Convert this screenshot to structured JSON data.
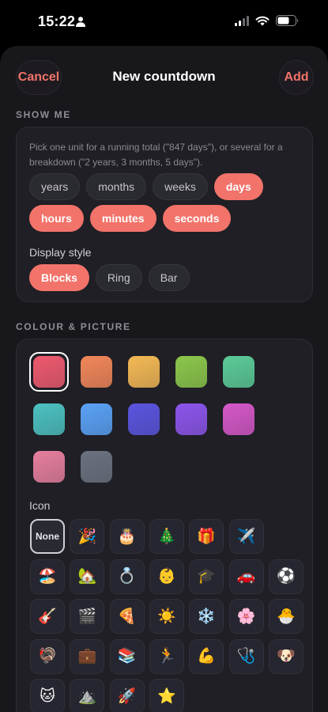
{
  "status": {
    "time": "15:22"
  },
  "nav": {
    "cancel": "Cancel",
    "title": "New countdown",
    "add": "Add"
  },
  "show_me": {
    "heading": "SHOW ME",
    "hint": "Pick one unit for a running total (\"847 days\"), or several for a breakdown (\"2 years, 3 months, 5 days\").",
    "units_row1": [
      {
        "label": "years",
        "active": false
      },
      {
        "label": "months",
        "active": false
      },
      {
        "label": "weeks",
        "active": false
      },
      {
        "label": "days",
        "active": true
      }
    ],
    "units_row2": [
      {
        "label": "hours",
        "active": true
      },
      {
        "label": "minutes",
        "active": true
      },
      {
        "label": "seconds",
        "active": true
      }
    ],
    "display_style_label": "Display style",
    "styles": [
      {
        "label": "Blocks",
        "active": true
      },
      {
        "label": "Ring",
        "active": false
      },
      {
        "label": "Bar",
        "active": false
      }
    ]
  },
  "colour": {
    "heading": "COLOUR & PICTURE",
    "swatches": [
      {
        "color": "#ee5a6f",
        "selected": true
      },
      {
        "color": "#f2875a",
        "selected": false
      },
      {
        "color": "#f4b955",
        "selected": false
      },
      {
        "color": "#8cc84b",
        "selected": false
      },
      {
        "color": "#5bcc98",
        "selected": false
      },
      {
        "color": "#4cc1c1",
        "selected": false
      },
      {
        "color": "#5aa2f7",
        "selected": false
      },
      {
        "color": "#5b55e0",
        "selected": false
      },
      {
        "color": "#8c55ec",
        "selected": false
      },
      {
        "color": "#d558c8",
        "selected": false
      },
      {
        "color": "#e67f9e",
        "selected": false
      },
      {
        "color": "#6b7280",
        "selected": false
      }
    ],
    "icon_label": "Icon",
    "icons": [
      {
        "name": "none",
        "glyph": "None"
      },
      {
        "name": "party-popper-icon",
        "glyph": "🎉"
      },
      {
        "name": "birthday-cake-icon",
        "glyph": "🎂"
      },
      {
        "name": "christmas-tree-icon",
        "glyph": "🎄"
      },
      {
        "name": "gift-icon",
        "glyph": "🎁"
      },
      {
        "name": "airplane-icon",
        "glyph": "✈️"
      },
      {
        "name": "beach-umbrella-icon",
        "glyph": "🏖️"
      },
      {
        "name": "house-icon",
        "glyph": "🏡"
      },
      {
        "name": "ring-icon",
        "glyph": "💍"
      },
      {
        "name": "baby-icon",
        "glyph": "👶"
      },
      {
        "name": "graduation-cap-icon",
        "glyph": "🎓"
      },
      {
        "name": "car-icon",
        "glyph": "🚗"
      },
      {
        "name": "soccer-ball-icon",
        "glyph": "⚽"
      },
      {
        "name": "guitar-icon",
        "glyph": "🎸"
      },
      {
        "name": "clapper-board-icon",
        "glyph": "🎬"
      },
      {
        "name": "pizza-icon",
        "glyph": "🍕"
      },
      {
        "name": "sun-icon",
        "glyph": "☀️"
      },
      {
        "name": "snowflake-icon",
        "glyph": "❄️"
      },
      {
        "name": "cherry-blossom-icon",
        "glyph": "🌸"
      },
      {
        "name": "hatching-chick-icon",
        "glyph": "🐣"
      },
      {
        "name": "turkey-icon",
        "glyph": "🦃"
      },
      {
        "name": "briefcase-icon",
        "glyph": "💼"
      },
      {
        "name": "books-icon",
        "glyph": "📚"
      },
      {
        "name": "runner-icon",
        "glyph": "🏃"
      },
      {
        "name": "flexed-biceps-icon",
        "glyph": "💪"
      },
      {
        "name": "stethoscope-icon",
        "glyph": "🩺"
      },
      {
        "name": "dog-icon",
        "glyph": "🐶"
      },
      {
        "name": "cat-icon",
        "glyph": "🐱"
      },
      {
        "name": "mountain-icon",
        "glyph": "⛰️"
      },
      {
        "name": "rocket-icon",
        "glyph": "🚀"
      },
      {
        "name": "star-icon",
        "glyph": "⭐"
      }
    ]
  }
}
